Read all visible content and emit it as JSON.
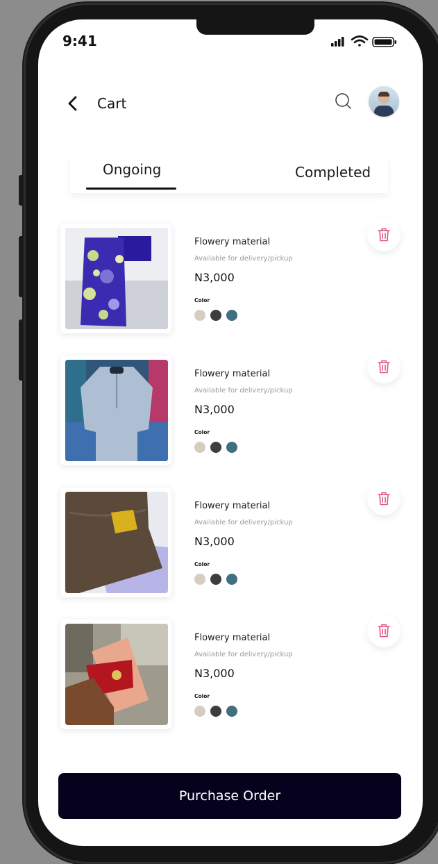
{
  "status_bar": {
    "time": "9:41"
  },
  "header": {
    "title": "Cart"
  },
  "tabs": [
    {
      "label": "Ongoing",
      "active": true
    },
    {
      "label": "Completed",
      "active": false
    }
  ],
  "cart_items": [
    {
      "name": "Flowery material",
      "availability": "Available for delivery/pickup",
      "price": "N3,000",
      "color_label": "Color",
      "image": "purple-floral-fabric"
    },
    {
      "name": "Flowery material",
      "availability": "Available for delivery/pickup",
      "price": "N3,000",
      "color_label": "Color",
      "image": "grey-kaftan-on-mannequin"
    },
    {
      "name": "Flowery material",
      "availability": "Available for delivery/pickup",
      "price": "N3,000",
      "color_label": "Color",
      "image": "brown-fabric-with-gold-tag"
    },
    {
      "name": "Flowery material",
      "availability": "Available for delivery/pickup",
      "price": "N3,000",
      "color_label": "Color",
      "image": "red-slipper-in-hand"
    }
  ],
  "swatch_colors": [
    "#d6cdc0",
    "#3e3c3e",
    "#3f6f81"
  ],
  "icons": {
    "back": "chevron-left-icon",
    "search": "search-icon",
    "delete": "trash-icon"
  },
  "theme": {
    "accent_delete": "#e2507a",
    "button_bg": "#06021d"
  },
  "footer": {
    "purchase_label": "Purchase Order"
  }
}
